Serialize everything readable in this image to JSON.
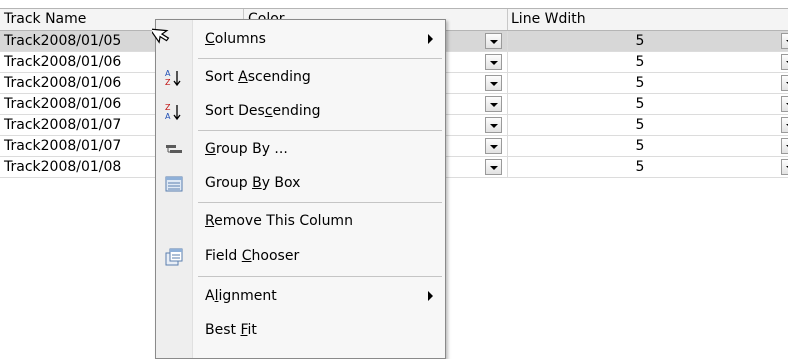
{
  "grid": {
    "headers": [
      "Track Name",
      "Color",
      "Line Wdith"
    ],
    "rows": [
      {
        "name": "Track2008/01/05",
        "width": "5"
      },
      {
        "name": "Track2008/01/06",
        "width": "5"
      },
      {
        "name": "Track2008/01/06",
        "width": "5"
      },
      {
        "name": "Track2008/01/06",
        "width": "5"
      },
      {
        "name": "Track2008/01/07",
        "width": "5"
      },
      {
        "name": "Track2008/01/07",
        "width": "5"
      },
      {
        "name": "Track2008/01/08",
        "width": "5"
      }
    ]
  },
  "menu": {
    "items": [
      {
        "pre": "",
        "ul": "C",
        "post": "olumns",
        "icon": "none",
        "submenu": true
      },
      {
        "pre": "Sort ",
        "ul": "A",
        "post": "scending",
        "icon": "sort-ascending-icon",
        "submenu": false
      },
      {
        "pre": "Sort Des",
        "ul": "c",
        "post": "ending",
        "icon": "sort-descending-icon",
        "submenu": false
      },
      {
        "pre": "",
        "ul": "G",
        "post": "roup By ...",
        "icon": "group-by-icon",
        "submenu": false
      },
      {
        "pre": "Group ",
        "ul": "B",
        "post": "y Box",
        "icon": "group-by-box-icon",
        "submenu": false
      },
      {
        "pre": "",
        "ul": "R",
        "post": "emove This Column",
        "icon": "none",
        "submenu": false
      },
      {
        "pre": "Field ",
        "ul": "C",
        "post": "hooser",
        "icon": "field-chooser-icon",
        "submenu": false
      },
      {
        "pre": "A",
        "ul": "l",
        "post": "ignment",
        "icon": "none",
        "submenu": true
      },
      {
        "pre": "Best ",
        "ul": "F",
        "post": "it",
        "icon": "none",
        "submenu": false
      }
    ]
  },
  "colors": {
    "selected_row": "#d7d7d7",
    "menu_background": "#f7f7f7",
    "header_background": "#f4f4f4"
  }
}
